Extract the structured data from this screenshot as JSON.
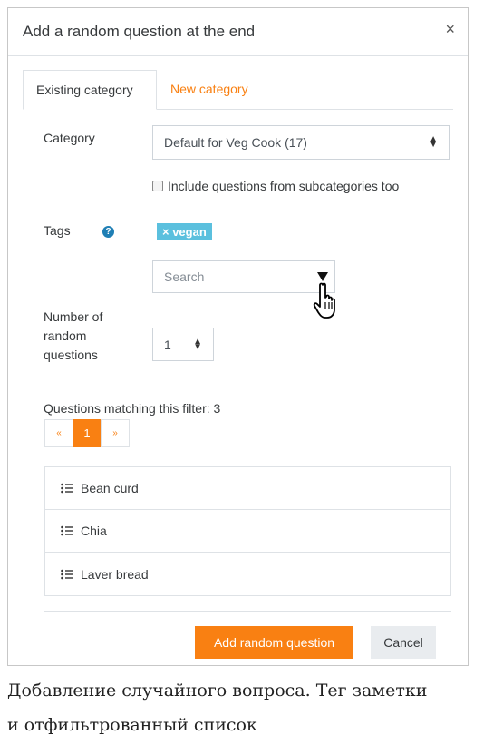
{
  "modal": {
    "title": "Add a random question at the end",
    "close_symbol": "×"
  },
  "tabs": [
    {
      "label": "Existing category",
      "active": true
    },
    {
      "label": "New category",
      "active": false
    }
  ],
  "category": {
    "label": "Category",
    "value": "Default for Veg Cook (17)"
  },
  "subcategories": {
    "label": "Include questions from subcategories too",
    "checked": false
  },
  "tags": {
    "label": "Tags",
    "help_symbol": "?",
    "selected": [
      {
        "label": "× vegan"
      }
    ],
    "search_placeholder": "Search"
  },
  "random_count": {
    "label_lines": [
      "Number of",
      "random",
      "questions"
    ],
    "value": "1"
  },
  "filter": {
    "matching_text": "Questions matching this filter: 3",
    "pagination": {
      "prev": "«",
      "current": "1",
      "next": "»"
    },
    "questions": [
      {
        "name": "Bean curd"
      },
      {
        "name": "Chia"
      },
      {
        "name": "Laver bread"
      }
    ]
  },
  "footer": {
    "primary_label": "Add random question",
    "cancel_label": "Cancel"
  },
  "caption": {
    "lines": [
      "Добавление случайного вопроса. Тег заметки",
      "и отфильтрованный список"
    ]
  },
  "colors": {
    "accent": "#f98012",
    "tag": "#5bc0de",
    "help": "#1f7fb5"
  },
  "icons": {
    "close": "close-icon",
    "help": "help-icon",
    "dropdown": "chevron-down-icon",
    "question": "multichoice-question-icon",
    "cursor": "hand-pointer-icon"
  }
}
